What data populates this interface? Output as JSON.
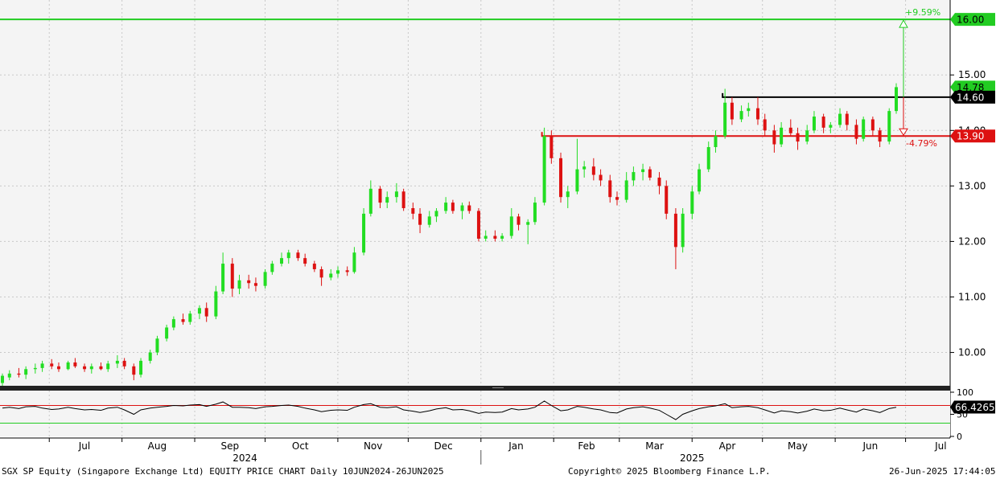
{
  "chart_data": {
    "type": "candlestick",
    "title": "",
    "price_axis": {
      "ylim": [
        9.4,
        16.35
      ],
      "ticks": [
        "10.00",
        "11.00",
        "12.00",
        "13.00",
        "14.00",
        "15.00",
        "16.00"
      ]
    },
    "x_axis": {
      "months": [
        "Jul",
        "Aug",
        "Sep",
        "Oct",
        "Nov",
        "Dec",
        "Jan",
        "Feb",
        "Mar",
        "Apr",
        "May",
        "Jun",
        "Jul"
      ],
      "years": [
        "2024",
        "2025"
      ]
    },
    "candle_colors": {
      "up": "#22dd22",
      "down": "#dd1111"
    },
    "candles": [
      {
        "date": "2024-06-10",
        "open": 9.45,
        "high": 9.62,
        "low": 9.38,
        "close": 9.58
      },
      {
        "date": "2024-06-13",
        "open": 9.55,
        "high": 9.68,
        "low": 9.5,
        "close": 9.62
      },
      {
        "date": "2024-06-17",
        "open": 9.62,
        "high": 9.72,
        "low": 9.55,
        "close": 9.6
      },
      {
        "date": "2024-06-20",
        "open": 9.6,
        "high": 9.75,
        "low": 9.52,
        "close": 9.7
      },
      {
        "date": "2024-06-24",
        "open": 9.7,
        "high": 9.8,
        "low": 9.62,
        "close": 9.72
      },
      {
        "date": "2024-06-27",
        "open": 9.72,
        "high": 9.85,
        "low": 9.65,
        "close": 9.8
      },
      {
        "date": "2024-07-01",
        "open": 9.8,
        "high": 9.88,
        "low": 9.7,
        "close": 9.75
      },
      {
        "date": "2024-07-04",
        "open": 9.75,
        "high": 9.82,
        "low": 9.65,
        "close": 9.7
      },
      {
        "date": "2024-07-08",
        "open": 9.7,
        "high": 9.85,
        "low": 9.68,
        "close": 9.82
      },
      {
        "date": "2024-07-11",
        "open": 9.82,
        "high": 9.9,
        "low": 9.72,
        "close": 9.75
      },
      {
        "date": "2024-07-15",
        "open": 9.75,
        "high": 9.8,
        "low": 9.65,
        "close": 9.7
      },
      {
        "date": "2024-07-18",
        "open": 9.7,
        "high": 9.8,
        "low": 9.62,
        "close": 9.75
      },
      {
        "date": "2024-07-22",
        "open": 9.75,
        "high": 9.82,
        "low": 9.68,
        "close": 9.7
      },
      {
        "date": "2024-07-25",
        "open": 9.7,
        "high": 9.85,
        "low": 9.65,
        "close": 9.8
      },
      {
        "date": "2024-07-29",
        "open": 9.8,
        "high": 9.95,
        "low": 9.72,
        "close": 9.85
      },
      {
        "date": "2024-08-01",
        "open": 9.85,
        "high": 9.9,
        "low": 9.7,
        "close": 9.75
      },
      {
        "date": "2024-08-05",
        "open": 9.75,
        "high": 9.8,
        "low": 9.5,
        "close": 9.6
      },
      {
        "date": "2024-08-08",
        "open": 9.6,
        "high": 9.9,
        "low": 9.55,
        "close": 9.85
      },
      {
        "date": "2024-08-12",
        "open": 9.85,
        "high": 10.05,
        "low": 9.8,
        "close": 10.0
      },
      {
        "date": "2024-08-15",
        "open": 10.0,
        "high": 10.3,
        "low": 9.95,
        "close": 10.25
      },
      {
        "date": "2024-08-19",
        "open": 10.25,
        "high": 10.5,
        "low": 10.2,
        "close": 10.45
      },
      {
        "date": "2024-08-22",
        "open": 10.45,
        "high": 10.65,
        "low": 10.4,
        "close": 10.6
      },
      {
        "date": "2024-08-26",
        "open": 10.6,
        "high": 10.7,
        "low": 10.5,
        "close": 10.55
      },
      {
        "date": "2024-08-29",
        "open": 10.55,
        "high": 10.75,
        "low": 10.5,
        "close": 10.7
      },
      {
        "date": "2024-09-02",
        "open": 10.7,
        "high": 10.85,
        "low": 10.6,
        "close": 10.8
      },
      {
        "date": "2024-09-05",
        "open": 10.8,
        "high": 10.9,
        "low": 10.55,
        "close": 10.65
      },
      {
        "date": "2024-09-09",
        "open": 10.65,
        "high": 11.2,
        "low": 10.6,
        "close": 11.1
      },
      {
        "date": "2024-09-12",
        "open": 11.1,
        "high": 11.8,
        "low": 11.05,
        "close": 11.6
      },
      {
        "date": "2024-09-16",
        "open": 11.6,
        "high": 11.7,
        "low": 11.0,
        "close": 11.15
      },
      {
        "date": "2024-09-19",
        "open": 11.15,
        "high": 11.4,
        "low": 11.05,
        "close": 11.3
      },
      {
        "date": "2024-09-23",
        "open": 11.3,
        "high": 11.4,
        "low": 11.15,
        "close": 11.25
      },
      {
        "date": "2024-09-26",
        "open": 11.25,
        "high": 11.35,
        "low": 11.1,
        "close": 11.2
      },
      {
        "date": "2024-09-30",
        "open": 11.2,
        "high": 11.5,
        "low": 11.15,
        "close": 11.45
      },
      {
        "date": "2024-10-03",
        "open": 11.45,
        "high": 11.65,
        "low": 11.4,
        "close": 11.6
      },
      {
        "date": "2024-10-07",
        "open": 11.6,
        "high": 11.8,
        "low": 11.55,
        "close": 11.7
      },
      {
        "date": "2024-10-10",
        "open": 11.7,
        "high": 11.85,
        "low": 11.6,
        "close": 11.8
      },
      {
        "date": "2024-10-14",
        "open": 11.8,
        "high": 11.85,
        "low": 11.65,
        "close": 11.7
      },
      {
        "date": "2024-10-17",
        "open": 11.7,
        "high": 11.78,
        "low": 11.55,
        "close": 11.6
      },
      {
        "date": "2024-10-21",
        "open": 11.6,
        "high": 11.65,
        "low": 11.45,
        "close": 11.5
      },
      {
        "date": "2024-10-24",
        "open": 11.5,
        "high": 11.55,
        "low": 11.2,
        "close": 11.35
      },
      {
        "date": "2024-10-28",
        "open": 11.35,
        "high": 11.5,
        "low": 11.3,
        "close": 11.42
      },
      {
        "date": "2024-10-31",
        "open": 11.42,
        "high": 11.55,
        "low": 11.35,
        "close": 11.48
      },
      {
        "date": "2024-11-04",
        "open": 11.48,
        "high": 11.55,
        "low": 11.38,
        "close": 11.45
      },
      {
        "date": "2024-11-07",
        "open": 11.45,
        "high": 11.9,
        "low": 11.42,
        "close": 11.8
      },
      {
        "date": "2024-11-11",
        "open": 11.8,
        "high": 12.6,
        "low": 11.75,
        "close": 12.5
      },
      {
        "date": "2024-11-14",
        "open": 12.5,
        "high": 13.1,
        "low": 12.45,
        "close": 12.95
      },
      {
        "date": "2024-11-18",
        "open": 12.95,
        "high": 13.0,
        "low": 12.6,
        "close": 12.7
      },
      {
        "date": "2024-11-21",
        "open": 12.7,
        "high": 12.9,
        "low": 12.6,
        "close": 12.8
      },
      {
        "date": "2024-11-25",
        "open": 12.8,
        "high": 13.05,
        "low": 12.7,
        "close": 12.9
      },
      {
        "date": "2024-11-28",
        "open": 12.9,
        "high": 12.95,
        "low": 12.55,
        "close": 12.6
      },
      {
        "date": "2024-12-02",
        "open": 12.6,
        "high": 12.7,
        "low": 12.4,
        "close": 12.5
      },
      {
        "date": "2024-12-05",
        "open": 12.5,
        "high": 12.6,
        "low": 12.15,
        "close": 12.3
      },
      {
        "date": "2024-12-09",
        "open": 12.3,
        "high": 12.55,
        "low": 12.25,
        "close": 12.45
      },
      {
        "date": "2024-12-12",
        "open": 12.45,
        "high": 12.6,
        "low": 12.35,
        "close": 12.55
      },
      {
        "date": "2024-12-16",
        "open": 12.55,
        "high": 12.8,
        "low": 12.5,
        "close": 12.7
      },
      {
        "date": "2024-12-19",
        "open": 12.7,
        "high": 12.75,
        "low": 12.5,
        "close": 12.55
      },
      {
        "date": "2024-12-23",
        "open": 12.55,
        "high": 12.7,
        "low": 12.4,
        "close": 12.65
      },
      {
        "date": "2024-12-26",
        "open": 12.65,
        "high": 12.72,
        "low": 12.5,
        "close": 12.55
      },
      {
        "date": "2024-12-30",
        "open": 12.55,
        "high": 12.6,
        "low": 12.0,
        "close": 12.05
      },
      {
        "date": "2025-01-02",
        "open": 12.05,
        "high": 12.2,
        "low": 12.0,
        "close": 12.1
      },
      {
        "date": "2025-01-06",
        "open": 12.1,
        "high": 12.2,
        "low": 12.0,
        "close": 12.05
      },
      {
        "date": "2025-01-09",
        "open": 12.05,
        "high": 12.15,
        "low": 12.0,
        "close": 12.1
      },
      {
        "date": "2025-01-13",
        "open": 12.1,
        "high": 12.6,
        "low": 12.05,
        "close": 12.45
      },
      {
        "date": "2025-01-16",
        "open": 12.45,
        "high": 12.5,
        "low": 12.2,
        "close": 12.3
      },
      {
        "date": "2025-01-20",
        "open": 12.3,
        "high": 12.4,
        "low": 11.95,
        "close": 12.35
      },
      {
        "date": "2025-01-23",
        "open": 12.35,
        "high": 12.8,
        "low": 12.3,
        "close": 12.7
      },
      {
        "date": "2025-01-27",
        "open": 12.7,
        "high": 14.05,
        "low": 12.65,
        "close": 13.9
      },
      {
        "date": "2025-01-30",
        "open": 13.9,
        "high": 14.0,
        "low": 13.4,
        "close": 13.5
      },
      {
        "date": "2025-02-03",
        "open": 13.5,
        "high": 13.6,
        "low": 12.7,
        "close": 12.8
      },
      {
        "date": "2025-02-06",
        "open": 12.8,
        "high": 13.0,
        "low": 12.6,
        "close": 12.9
      },
      {
        "date": "2025-02-10",
        "open": 12.9,
        "high": 13.85,
        "low": 12.85,
        "close": 13.3
      },
      {
        "date": "2025-02-13",
        "open": 13.3,
        "high": 13.45,
        "low": 13.15,
        "close": 13.35
      },
      {
        "date": "2025-02-17",
        "open": 13.35,
        "high": 13.5,
        "low": 13.1,
        "close": 13.2
      },
      {
        "date": "2025-02-20",
        "open": 13.2,
        "high": 13.3,
        "low": 13.0,
        "close": 13.1
      },
      {
        "date": "2025-02-24",
        "open": 13.1,
        "high": 13.2,
        "low": 12.7,
        "close": 12.8
      },
      {
        "date": "2025-02-27",
        "open": 12.8,
        "high": 12.9,
        "low": 12.65,
        "close": 12.75
      },
      {
        "date": "2025-03-03",
        "open": 12.75,
        "high": 13.25,
        "low": 12.7,
        "close": 13.1
      },
      {
        "date": "2025-03-06",
        "open": 13.1,
        "high": 13.35,
        "low": 13.0,
        "close": 13.25
      },
      {
        "date": "2025-03-10",
        "open": 13.25,
        "high": 13.4,
        "low": 13.1,
        "close": 13.3
      },
      {
        "date": "2025-03-13",
        "open": 13.3,
        "high": 13.35,
        "low": 13.1,
        "close": 13.15
      },
      {
        "date": "2025-03-17",
        "open": 13.15,
        "high": 13.25,
        "low": 12.85,
        "close": 13.0
      },
      {
        "date": "2025-03-20",
        "open": 13.0,
        "high": 13.1,
        "low": 12.4,
        "close": 12.5
      },
      {
        "date": "2025-03-24",
        "open": 12.5,
        "high": 12.6,
        "low": 11.5,
        "close": 11.9
      },
      {
        "date": "2025-03-27",
        "open": 11.9,
        "high": 12.6,
        "low": 11.8,
        "close": 12.5
      },
      {
        "date": "2025-03-31",
        "open": 12.5,
        "high": 13.0,
        "low": 12.4,
        "close": 12.9
      },
      {
        "date": "2025-04-03",
        "open": 12.9,
        "high": 13.4,
        "low": 12.85,
        "close": 13.3
      },
      {
        "date": "2025-04-07",
        "open": 13.3,
        "high": 13.8,
        "low": 13.25,
        "close": 13.7
      },
      {
        "date": "2025-04-10",
        "open": 13.7,
        "high": 14.0,
        "low": 13.6,
        "close": 13.9
      },
      {
        "date": "2025-04-14",
        "open": 13.9,
        "high": 14.75,
        "low": 13.85,
        "close": 14.5
      },
      {
        "date": "2025-04-17",
        "open": 14.5,
        "high": 14.6,
        "low": 14.1,
        "close": 14.2
      },
      {
        "date": "2025-04-21",
        "open": 14.2,
        "high": 14.45,
        "low": 14.15,
        "close": 14.35
      },
      {
        "date": "2025-04-24",
        "open": 14.35,
        "high": 14.5,
        "low": 14.25,
        "close": 14.4
      },
      {
        "date": "2025-04-28",
        "open": 14.4,
        "high": 14.6,
        "low": 14.1,
        "close": 14.2
      },
      {
        "date": "2025-05-01",
        "open": 14.2,
        "high": 14.3,
        "low": 13.9,
        "close": 14.0
      },
      {
        "date": "2025-05-05",
        "open": 14.0,
        "high": 14.1,
        "low": 13.6,
        "close": 13.75
      },
      {
        "date": "2025-05-08",
        "open": 13.75,
        "high": 14.15,
        "low": 13.7,
        "close": 14.05
      },
      {
        "date": "2025-05-12",
        "open": 14.05,
        "high": 14.2,
        "low": 13.9,
        "close": 13.95
      },
      {
        "date": "2025-05-15",
        "open": 13.95,
        "high": 14.05,
        "low": 13.65,
        "close": 13.8
      },
      {
        "date": "2025-05-19",
        "open": 13.8,
        "high": 14.1,
        "low": 13.75,
        "close": 14.0
      },
      {
        "date": "2025-05-22",
        "open": 14.0,
        "high": 14.35,
        "low": 13.95,
        "close": 14.25
      },
      {
        "date": "2025-05-26",
        "open": 14.25,
        "high": 14.3,
        "low": 13.95,
        "close": 14.05
      },
      {
        "date": "2025-05-29",
        "open": 14.05,
        "high": 14.15,
        "low": 13.95,
        "close": 14.1
      },
      {
        "date": "2025-06-02",
        "open": 14.1,
        "high": 14.4,
        "low": 14.05,
        "close": 14.3
      },
      {
        "date": "2025-06-05",
        "open": 14.3,
        "high": 14.35,
        "low": 14.0,
        "close": 14.1
      },
      {
        "date": "2025-06-09",
        "open": 14.1,
        "high": 14.2,
        "low": 13.75,
        "close": 13.85
      },
      {
        "date": "2025-06-12",
        "open": 13.85,
        "high": 14.25,
        "low": 13.8,
        "close": 14.2
      },
      {
        "date": "2025-06-16",
        "open": 14.2,
        "high": 14.25,
        "low": 13.9,
        "close": 14.0
      },
      {
        "date": "2025-06-19",
        "open": 14.0,
        "high": 14.05,
        "low": 13.7,
        "close": 13.8
      },
      {
        "date": "2025-06-23",
        "open": 13.8,
        "high": 14.4,
        "low": 13.75,
        "close": 14.35
      },
      {
        "date": "2025-06-26",
        "open": 14.35,
        "high": 14.85,
        "low": 14.3,
        "close": 14.78
      }
    ],
    "levels": [
      {
        "label": "16.00",
        "value": 16.0,
        "color": "#22cc22",
        "start": "2024-06-10",
        "box_bg": "#22cc22",
        "box_fg": "#000000"
      },
      {
        "label": "14.60",
        "value": 14.6,
        "color": "#000000",
        "start": "2025-04-14",
        "box_bg": "#000000",
        "box_fg": "#ffffff"
      },
      {
        "label": "13.90",
        "value": 13.9,
        "color": "#dd1111",
        "start": "2025-01-27",
        "box_bg": "#dd1111",
        "box_fg": "#ffffff"
      }
    ],
    "last_price": {
      "label": "14.78",
      "value": 14.78,
      "box_bg": "#22cc22",
      "box_fg": "#000000"
    },
    "up_target": {
      "label": "+9.59%",
      "color": "#22cc22"
    },
    "down_target": {
      "label": "-4.79%",
      "color": "#dd1111"
    },
    "rsi": {
      "ticks": [
        "100",
        "50",
        "0"
      ],
      "overbought": 70,
      "oversold": 30,
      "last_label": "66.4265",
      "values": [
        64,
        66,
        63,
        67,
        68,
        64,
        61,
        62,
        66,
        63,
        60,
        61,
        59,
        64,
        66,
        60,
        50,
        60,
        64,
        66,
        68,
        70,
        69,
        71,
        72,
        68,
        73,
        78,
        66,
        66,
        65,
        63,
        67,
        68,
        70,
        71,
        68,
        64,
        60,
        56,
        59,
        60,
        59,
        66,
        72,
        74,
        66,
        65,
        67,
        60,
        57,
        54,
        58,
        62,
        65,
        60,
        61,
        58,
        52,
        55,
        54,
        55,
        63,
        60,
        62,
        66,
        80,
        70,
        58,
        60,
        68,
        66,
        62,
        60,
        54,
        53,
        62,
        65,
        67,
        64,
        59,
        50,
        38,
        50,
        58,
        63,
        67,
        69,
        74,
        65,
        67,
        68,
        65,
        60,
        53,
        58,
        56,
        53,
        57,
        62,
        58,
        59,
        64,
        60,
        55,
        62,
        58,
        54,
        63,
        66
      ]
    }
  },
  "footer": {
    "left": "SGX SP Equity (Singapore Exchange Ltd) EQUITY PRICE CHART  Daily 10JUN2024-26JUN2025",
    "center": "Copyright© 2025 Bloomberg Finance L.P.",
    "right": "26-Jun-2025 17:44:05"
  }
}
